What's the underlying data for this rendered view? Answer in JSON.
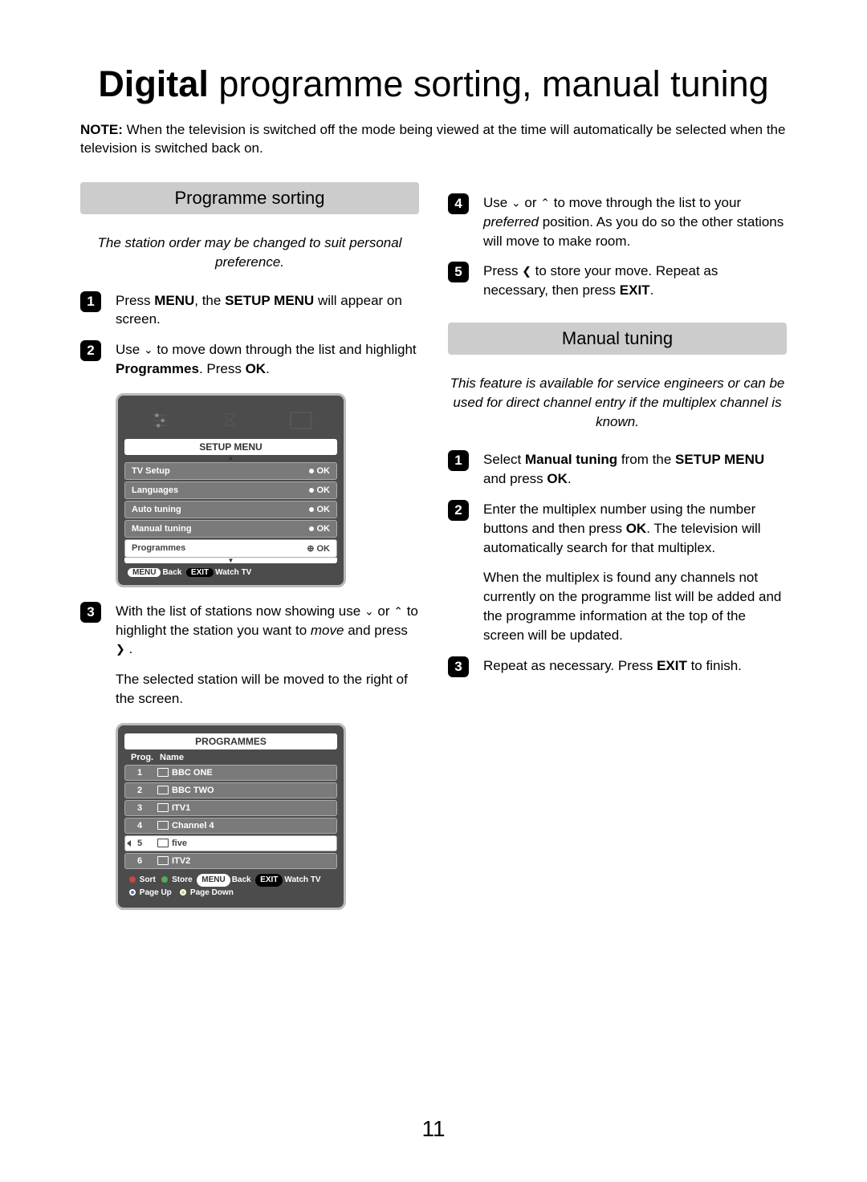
{
  "title_bold": "Digital",
  "title_rest": " programme sorting, manual tuning",
  "note_label": "NOTE:",
  "note_text": " When the television is switched off the mode being viewed at the time will automatically be selected when the television is switched back on.",
  "page_number": "11",
  "left": {
    "section": "Programme sorting",
    "intro": "The station order may be changed to suit personal preference.",
    "step1_a": "Press ",
    "step1_b": "MENU",
    "step1_c": ", the ",
    "step1_d": "SETUP MENU",
    "step1_e": " will appear on screen.",
    "step2_a": "Use ",
    "step2_b": " to move down through the list and highlight ",
    "step2_c": "Programmes",
    "step2_d": ". Press ",
    "step2_e": "OK",
    "step2_f": ".",
    "step3_a": "With the list of stations now showing use ",
    "step3_b": " or ",
    "step3_c": " to highlight the station you want to ",
    "step3_d": "move",
    "step3_e": " and press ",
    "step3_f": " .",
    "para3": "The selected station will be moved to the right of the screen."
  },
  "right": {
    "step4_a": "Use ",
    "step4_b": " or ",
    "step4_c": " to move through the list to your ",
    "step4_d": "preferred",
    "step4_e": " position. As you do so the other stations will move to make room.",
    "step5_a": "Press ",
    "step5_b": " to store your move. Repeat as necessary, then press ",
    "step5_c": "EXIT",
    "step5_d": ".",
    "section": "Manual tuning",
    "intro": "This feature is available for service engineers or can be used for direct channel entry if the multiplex channel is known.",
    "mstep1_a": "Select ",
    "mstep1_b": "Manual tuning",
    "mstep1_c": " from the ",
    "mstep1_d": "SETUP MENU",
    "mstep1_e": " and press ",
    "mstep1_f": "OK",
    "mstep1_g": ".",
    "mstep2_a": "Enter the multiplex number using the number buttons and then press ",
    "mstep2_b": "OK",
    "mstep2_c": ". The television will automatically search for that multiplex.",
    "mpara2": "When the multiplex is found any channels not currently on the programme list will be added and the programme information at the top of the screen will be updated.",
    "mstep3_a": "Repeat as necessary. Press ",
    "mstep3_b": "EXIT",
    "mstep3_c": " to finish."
  },
  "osd1": {
    "title": "SETUP MENU",
    "items": [
      {
        "label": "TV Setup",
        "ok": "OK"
      },
      {
        "label": "Languages",
        "ok": "OK"
      },
      {
        "label": "Auto tuning",
        "ok": "OK"
      },
      {
        "label": "Manual tuning",
        "ok": "OK"
      },
      {
        "label": "Programmes",
        "ok": "OK"
      }
    ],
    "footer_menu": "MENU",
    "footer_back": "Back",
    "footer_exit": "EXIT",
    "footer_watch": "Watch TV"
  },
  "osd2": {
    "title": "PROGRAMMES",
    "col_prog": "Prog.",
    "col_name": "Name",
    "rows": [
      {
        "n": "1",
        "name": "BBC ONE"
      },
      {
        "n": "2",
        "name": "BBC TWO"
      },
      {
        "n": "3",
        "name": "ITV1"
      },
      {
        "n": "4",
        "name": "Channel 4"
      },
      {
        "n": "5",
        "name": "five"
      },
      {
        "n": "6",
        "name": "ITV2"
      }
    ],
    "f_sort": "Sort",
    "f_store": "Store",
    "f_menu": "MENU",
    "f_back": "Back",
    "f_exit": "EXIT",
    "f_watch": "Watch TV",
    "f_pu": "Page Up",
    "f_pd": "Page Down"
  }
}
